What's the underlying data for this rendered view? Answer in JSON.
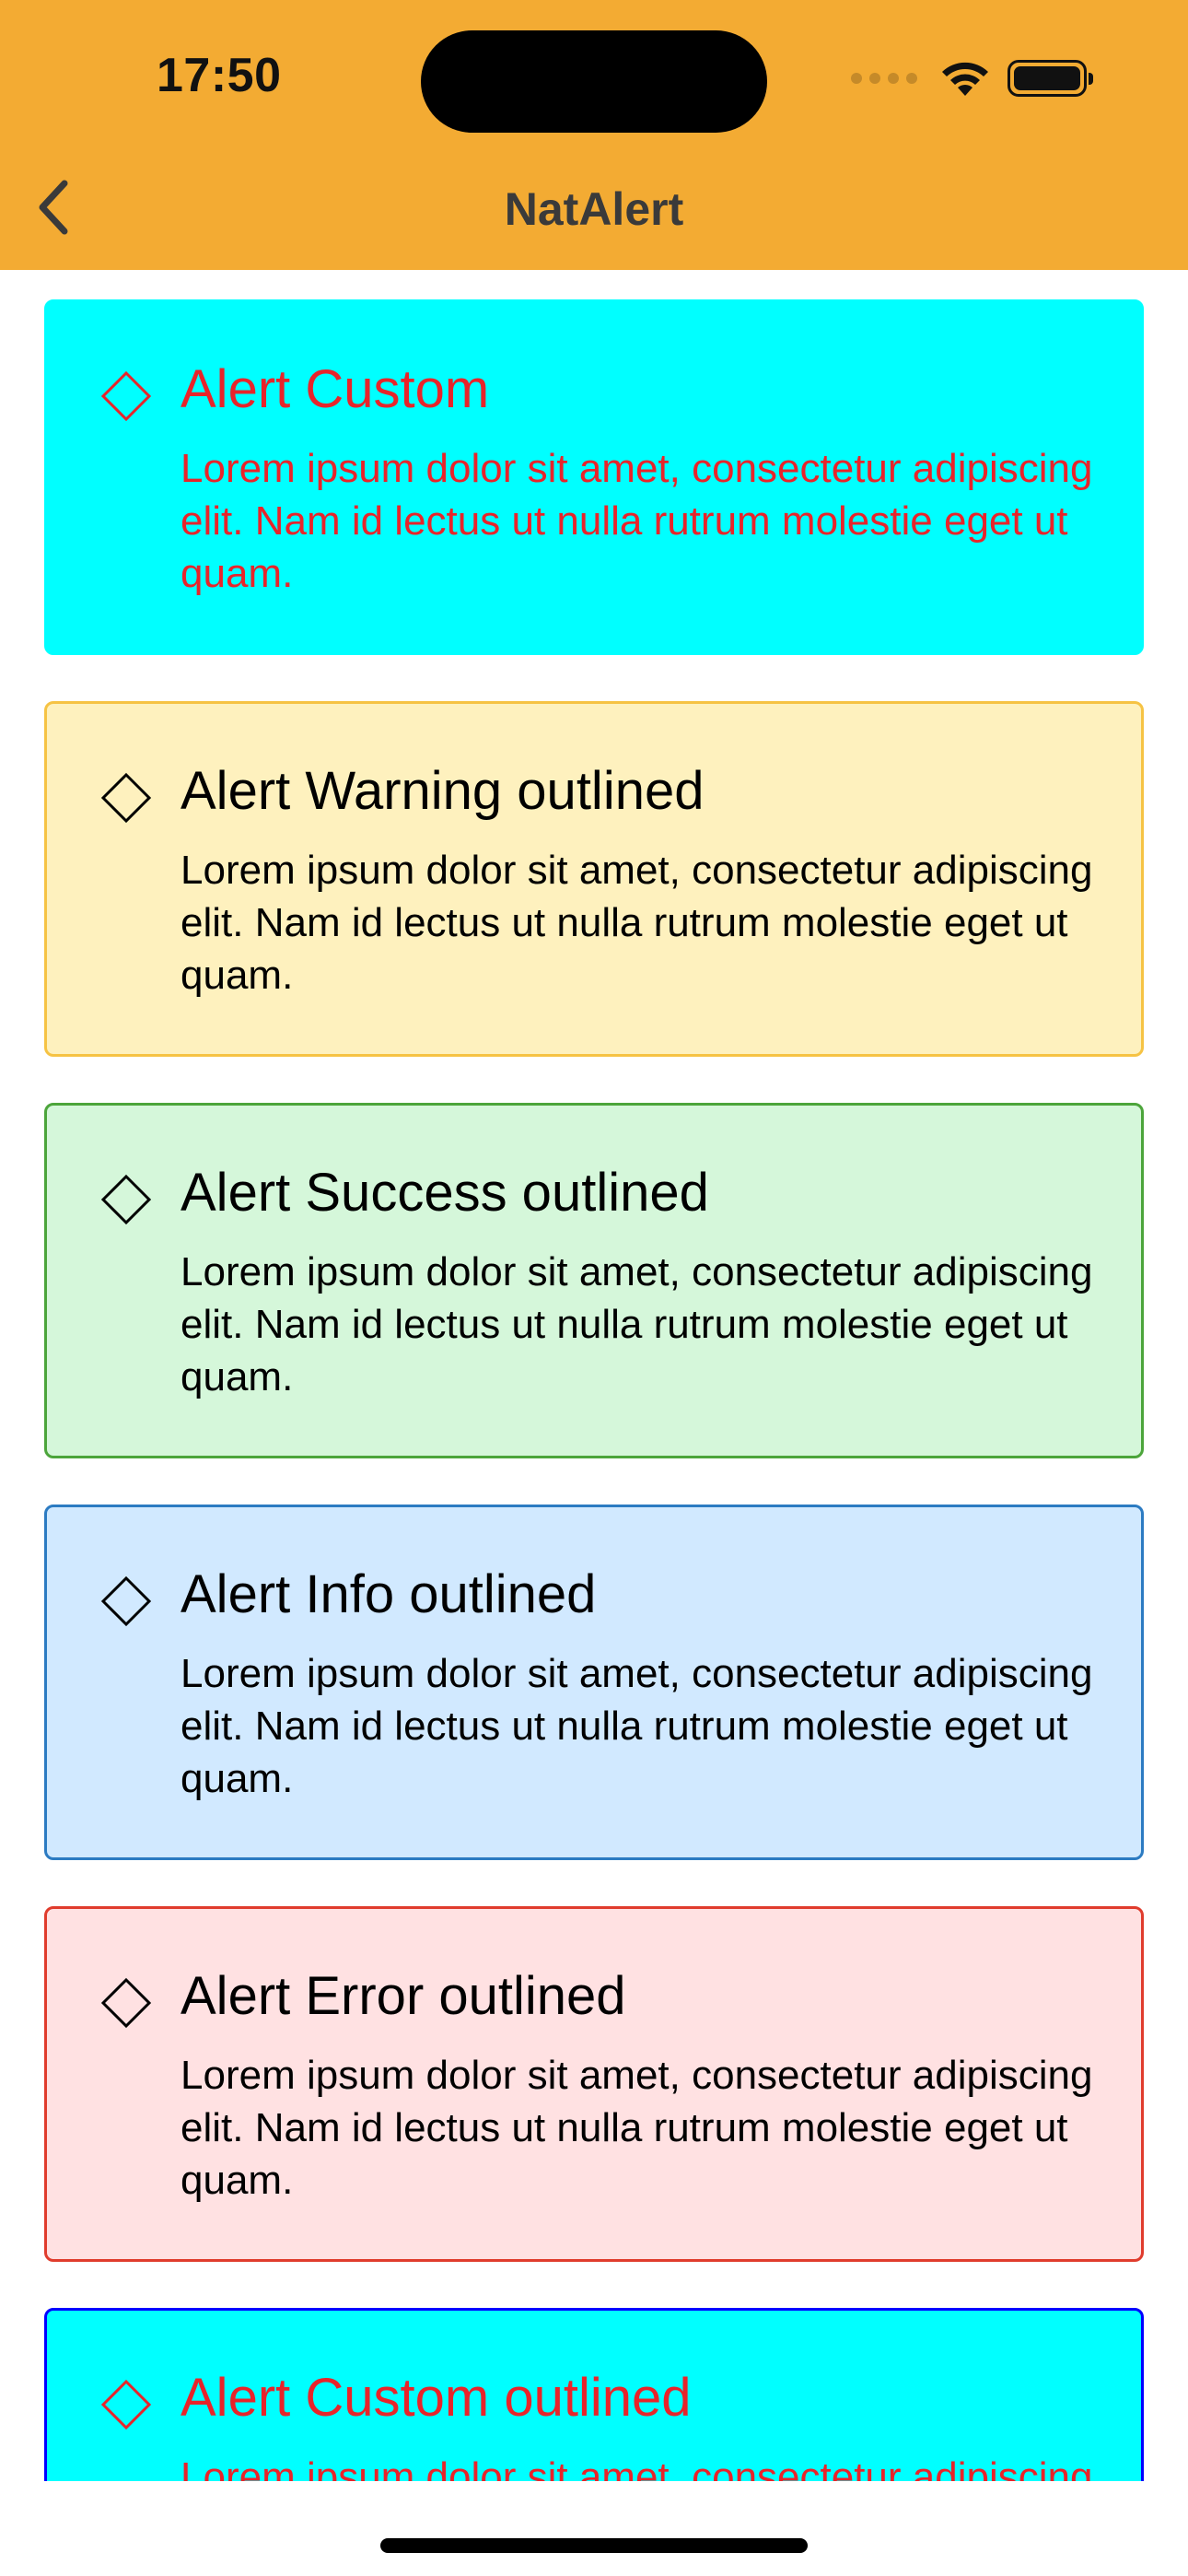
{
  "status_bar": {
    "time": "17:50",
    "icons": [
      "cellular-signal-icon",
      "wifi-icon",
      "battery-icon"
    ]
  },
  "nav": {
    "title": "NatAlert",
    "back_icon": "chevron-left-icon"
  },
  "alerts": [
    {
      "title": "Alert Custom",
      "body": "Lorem ipsum dolor sit amet, consectetur adipiscing elit. Nam id lectus ut nulla rutrum molestie eget ut quam.",
      "icon": "diamond-icon",
      "background": "#00FFFF",
      "border": "#00FFFF",
      "text_color": "#E8242A"
    },
    {
      "title": "Alert Warning outlined",
      "body": "Lorem ipsum dolor sit amet, consectetur adipiscing elit. Nam id lectus ut nulla rutrum molestie eget ut quam.",
      "icon": "diamond-icon",
      "background": "#FEF1BE",
      "border": "#F6C344",
      "text_color": "#000000"
    },
    {
      "title": "Alert Success outlined",
      "body": "Lorem ipsum dolor sit amet, consectetur adipiscing elit. Nam id lectus ut nulla rutrum molestie eget ut quam.",
      "icon": "diamond-icon",
      "background": "#D5F7DA",
      "border": "#4CA53B",
      "text_color": "#000000"
    },
    {
      "title": "Alert Info outlined",
      "body": "Lorem ipsum dolor sit amet, consectetur adipiscing elit. Nam id lectus ut nulla rutrum molestie eget ut quam.",
      "icon": "diamond-icon",
      "background": "#D1E9FF",
      "border": "#2C7BC2",
      "text_color": "#000000"
    },
    {
      "title": "Alert Error outlined",
      "body": "Lorem ipsum dolor sit amet, consectetur adipiscing elit. Nam id lectus ut nulla rutrum molestie eget ut quam.",
      "icon": "diamond-icon",
      "background": "#FFE1E2",
      "border": "#E03C2D",
      "text_color": "#000000"
    },
    {
      "title": "Alert Custom outlined",
      "body": "Lorem ipsum dolor sit amet, consectetur adipiscing elit. Nam id lectus ut nulla rutrum molestie eget ut quam.",
      "icon": "diamond-icon",
      "background": "#00FFFF",
      "border": "#0000FF",
      "text_color": "#E8242A"
    }
  ],
  "colors": {
    "header": "#F3AB33",
    "page_background": "#FFFFFF"
  }
}
